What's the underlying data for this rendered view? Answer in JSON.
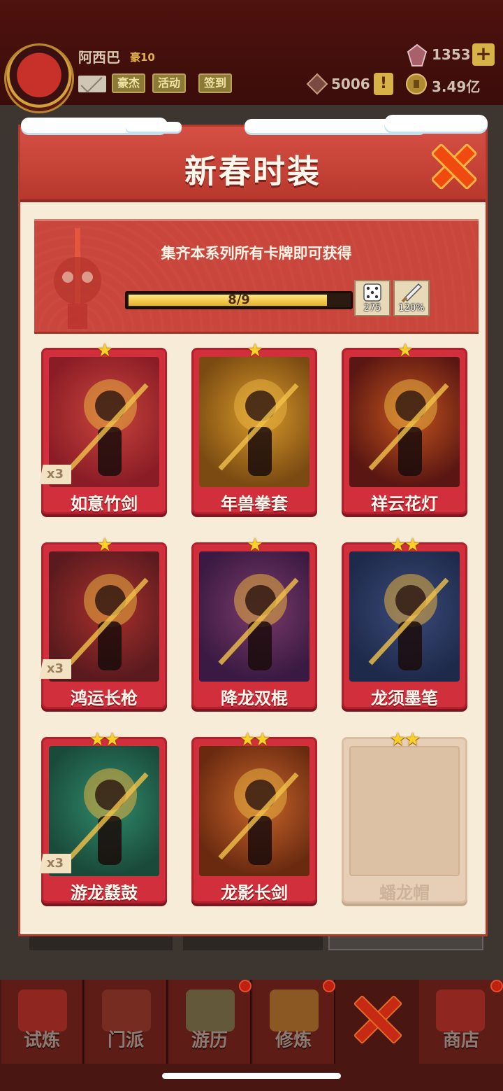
{
  "player": {
    "name": "阿西巴",
    "rank": "豪10",
    "tags": [
      "豪杰",
      "活动",
      "签到"
    ]
  },
  "resources": {
    "gems": "1353",
    "tokens": "5006",
    "coins": "3.49亿"
  },
  "modal": {
    "title": "新春时装",
    "collection_text": "集齐本系列所有卡牌即可获得",
    "progress_text": "8/9",
    "progress_fraction": 0.889,
    "rewards": [
      {
        "icon": "dice-icon",
        "label": "275"
      },
      {
        "icon": "sword-icon",
        "label": "120%"
      }
    ]
  },
  "cards": [
    {
      "name": "如意竹剑",
      "stars": "★",
      "count": "x3",
      "colors": [
        "#8a1c26",
        "#c8453c"
      ]
    },
    {
      "name": "年兽拳套",
      "stars": "★",
      "count": "",
      "colors": [
        "#7a4a12",
        "#d89a2a"
      ]
    },
    {
      "name": "祥云花灯",
      "stars": "★",
      "count": "",
      "colors": [
        "#5a1612",
        "#c2541e"
      ]
    },
    {
      "name": "鸿运长枪",
      "stars": "★",
      "count": "x3",
      "colors": [
        "#5a1a1e",
        "#a8302c"
      ]
    },
    {
      "name": "降龙双棍",
      "stars": "★",
      "count": "",
      "colors": [
        "#3a1a42",
        "#7a3a6a"
      ]
    },
    {
      "name": "龙须墨笔",
      "stars": "★★",
      "count": "",
      "colors": [
        "#1e2a4a",
        "#3a4a7a"
      ]
    },
    {
      "name": "游龙鼗鼓",
      "stars": "★★",
      "count": "x3",
      "colors": [
        "#1a4a3a",
        "#2f8a6a"
      ]
    },
    {
      "name": "龙影长剑",
      "stars": "★★",
      "count": "",
      "colors": [
        "#6a2a10",
        "#c8652a"
      ]
    },
    {
      "name": "蟠龙帽",
      "stars": "★★",
      "count": "",
      "locked": true,
      "colors": [
        "#dcc1a5",
        "#dcc1a5"
      ]
    }
  ],
  "bottom_nav": [
    "试炼",
    "门派",
    "游历",
    "修炼",
    "商店"
  ]
}
